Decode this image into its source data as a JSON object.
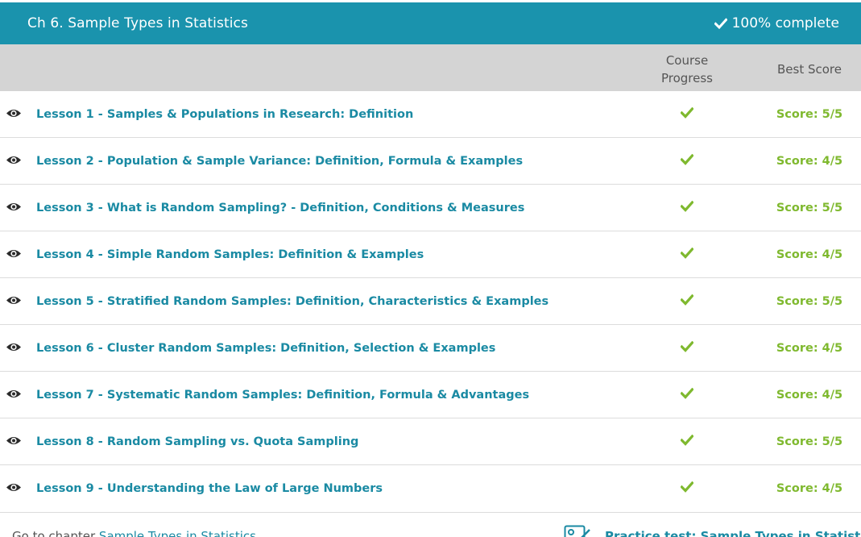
{
  "header": {
    "title": "Ch 6. Sample Types in Statistics",
    "complete": "100% complete"
  },
  "columns": {
    "progress_line1": "Course",
    "progress_line2": "Progress",
    "best": "Best Score"
  },
  "lessons": [
    {
      "title": "Lesson 1 - Samples & Populations in Research: Definition",
      "score": "Score: 5/5",
      "completed": true
    },
    {
      "title": "Lesson 2 - Population & Sample Variance: Definition, Formula & Examples",
      "score": "Score: 4/5",
      "completed": true
    },
    {
      "title": "Lesson 3 - What is Random Sampling? - Definition, Conditions & Measures",
      "score": "Score: 5/5",
      "completed": true
    },
    {
      "title": "Lesson 4 - Simple Random Samples: Definition & Examples",
      "score": "Score: 4/5",
      "completed": true
    },
    {
      "title": "Lesson 5 - Stratified Random Samples: Definition, Characteristics & Examples",
      "score": "Score: 5/5",
      "completed": true
    },
    {
      "title": "Lesson 6 - Cluster Random Samples: Definition, Selection & Examples",
      "score": "Score: 4/5",
      "completed": true
    },
    {
      "title": "Lesson 7 - Systematic Random Samples: Definition, Formula & Advantages",
      "score": "Score: 4/5",
      "completed": true
    },
    {
      "title": "Lesson 8 - Random Sampling vs. Quota Sampling",
      "score": "Score: 5/5",
      "completed": true
    },
    {
      "title": "Lesson 9 - Understanding the Law of Large Numbers",
      "score": "Score: 4/5",
      "completed": true
    }
  ],
  "footer": {
    "goto_prefix": "Go to chapter",
    "goto_link": "Sample Types in Statistics",
    "practice": "Practice test: Sample Types in Statistics"
  },
  "colors": {
    "header_bg": "#1a93ad",
    "link": "#1a8aa3",
    "success": "#7fb92f"
  },
  "icons": {
    "complete": "check-icon",
    "lesson_view": "eye-icon",
    "practice": "test-icon"
  }
}
